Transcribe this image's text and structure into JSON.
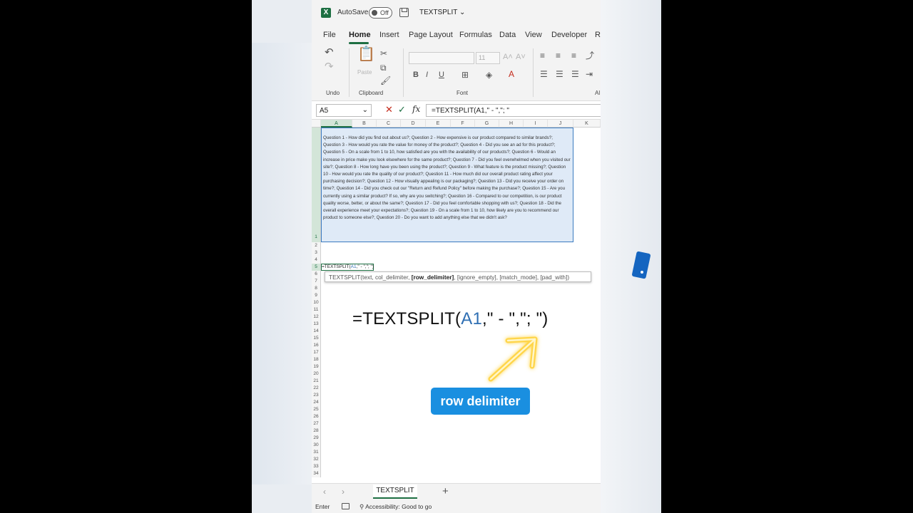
{
  "window": {
    "autosave_label": "AutoSave",
    "autosave_state": "Off",
    "doc_title": "TEXTSPLIT"
  },
  "tabs": [
    "File",
    "Home",
    "Insert",
    "Page Layout",
    "Formulas",
    "Data",
    "View",
    "Developer",
    "Re"
  ],
  "ribbon": {
    "groups": {
      "undo": "Undo",
      "clipboard": "Clipboard",
      "font": "Font",
      "alignment": "Al"
    },
    "paste_label": "Paste",
    "font_size": "11"
  },
  "formula_bar": {
    "name_box": "A5",
    "formula": "=TEXTSPLIT(A1,\" - \",\"; \""
  },
  "columns": [
    "A",
    "B",
    "C",
    "D",
    "E",
    "F",
    "G",
    "H",
    "I",
    "J",
    "K"
  ],
  "rows": [
    "1",
    "2",
    "3",
    "4",
    "5",
    "6",
    "7",
    "8",
    "9",
    "10",
    "11",
    "12",
    "13",
    "14",
    "15",
    "16",
    "17",
    "18",
    "19",
    "20",
    "21",
    "22",
    "23",
    "24",
    "25",
    "26",
    "27",
    "28",
    "29",
    "30",
    "31",
    "32",
    "33",
    "34"
  ],
  "cell_a1": "Question 1 - How did you find out about us?; Question 2 - How expensive is our product compared to similar brands?; Question 3 - How would you rate the value for money of the product?; Question 4 - Did you see an ad for this product?; Question 5 - On a scale from 1 to 10, how satisfied are you with the availability of our products?; Question 6 - Would an increase in price make you look elsewhere for the same product?; Question 7 - Did you feel overwhelmed when you visited our site?; Question 8 - How long have you been using the product?; Question 9 - What feature is the product missing?; Question 10 - How would you rate the quality of our product?; Question 11 - How much did our overall product rating affect your purchasing decision?; Question 12 - How visually appealing is our packaging?; Question 13 - Did you receive your order on time?; Question 14 - Did you check out our \"Return and Refund Policy\" before making the purchase?; Question 15 - Are you currently using a similar product? If so, why are you switching?; Question 16 - Compared to our competition, is our product quality worse, better, or about the same?; Question 17 - Did you feel comfortable shopping with us?; Question 18 - Did the overall experience meet your expectations?; Question 19 - On a scale from 1 to 10, how likely are you to recommend our product to someone else?; Question 20 - Do you want to add anything else that we didn't ask?",
  "cell_edit": {
    "prefix": "=TEXTSPLIT(",
    "ref": "A1",
    "rest": ",\" - \",\"; \")"
  },
  "tooltip": {
    "before": "TEXTSPLIT(text, col_delimiter, ",
    "bold": "[row_delimiter]",
    "after": ", [ignore_empty], [match_mode], [pad_with])"
  },
  "overlay": {
    "formula_prefix": "=TEXTSPLIT(",
    "formula_ref": "A1",
    "formula_rest": ",\" - \",\"; \")",
    "callout": "row delimiter"
  },
  "sheet": {
    "tab": "TEXTSPLIT",
    "add": "+"
  },
  "status": {
    "mode": "Enter",
    "accessibility": "Accessibility: Good to go"
  },
  "colors": {
    "excel_green": "#1d6f42",
    "selection_blue": "#dfeaf7",
    "callout_blue": "#1a8fe0",
    "arrow_yellow": "#ffd54a"
  }
}
